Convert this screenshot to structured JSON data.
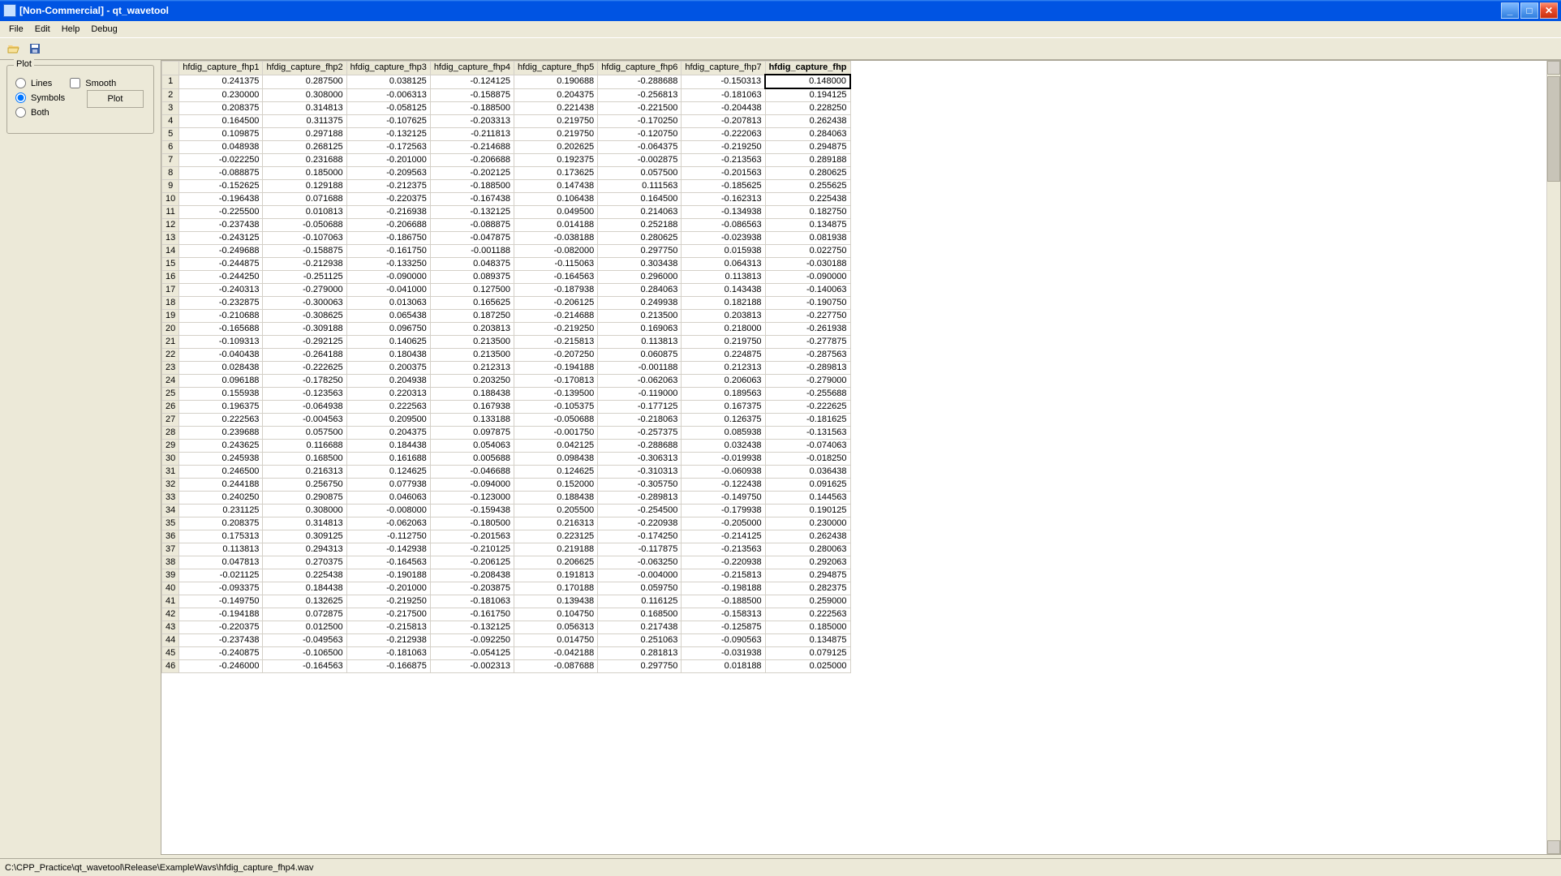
{
  "titlebar": {
    "text": "[Non-Commercial] - qt_wavetool"
  },
  "menu": {
    "file": "File",
    "edit": "Edit",
    "help": "Help",
    "debug": "Debug"
  },
  "plot": {
    "legend": "Plot",
    "lines": "Lines",
    "symbols": "Symbols",
    "both": "Both",
    "smooth": "Smooth",
    "plot_btn": "Plot"
  },
  "table": {
    "selected_col": 8,
    "selected_row": 1,
    "columns": [
      "hfdig_capture_fhp1",
      "hfdig_capture_fhp2",
      "hfdig_capture_fhp3",
      "hfdig_capture_fhp4",
      "hfdig_capture_fhp5",
      "hfdig_capture_fhp6",
      "hfdig_capture_fhp7",
      "hfdig_capture_fhp"
    ],
    "rows": [
      [
        "0.241375",
        "0.287500",
        "0.038125",
        "-0.124125",
        "0.190688",
        "-0.288688",
        "-0.150313",
        "0.148000"
      ],
      [
        "0.230000",
        "0.308000",
        "-0.006313",
        "-0.158875",
        "0.204375",
        "-0.256813",
        "-0.181063",
        "0.194125"
      ],
      [
        "0.208375",
        "0.314813",
        "-0.058125",
        "-0.188500",
        "0.221438",
        "-0.221500",
        "-0.204438",
        "0.228250"
      ],
      [
        "0.164500",
        "0.311375",
        "-0.107625",
        "-0.203313",
        "0.219750",
        "-0.170250",
        "-0.207813",
        "0.262438"
      ],
      [
        "0.109875",
        "0.297188",
        "-0.132125",
        "-0.211813",
        "0.219750",
        "-0.120750",
        "-0.222063",
        "0.284063"
      ],
      [
        "0.048938",
        "0.268125",
        "-0.172563",
        "-0.214688",
        "0.202625",
        "-0.064375",
        "-0.219250",
        "0.294875"
      ],
      [
        "-0.022250",
        "0.231688",
        "-0.201000",
        "-0.206688",
        "0.192375",
        "-0.002875",
        "-0.213563",
        "0.289188"
      ],
      [
        "-0.088875",
        "0.185000",
        "-0.209563",
        "-0.202125",
        "0.173625",
        "0.057500",
        "-0.201563",
        "0.280625"
      ],
      [
        "-0.152625",
        "0.129188",
        "-0.212375",
        "-0.188500",
        "0.147438",
        "0.111563",
        "-0.185625",
        "0.255625"
      ],
      [
        "-0.196438",
        "0.071688",
        "-0.220375",
        "-0.167438",
        "0.106438",
        "0.164500",
        "-0.162313",
        "0.225438"
      ],
      [
        "-0.225500",
        "0.010813",
        "-0.216938",
        "-0.132125",
        "0.049500",
        "0.214063",
        "-0.134938",
        "0.182750"
      ],
      [
        "-0.237438",
        "-0.050688",
        "-0.206688",
        "-0.088875",
        "0.014188",
        "0.252188",
        "-0.086563",
        "0.134875"
      ],
      [
        "-0.243125",
        "-0.107063",
        "-0.186750",
        "-0.047875",
        "-0.038188",
        "0.280625",
        "-0.023938",
        "0.081938"
      ],
      [
        "-0.249688",
        "-0.158875",
        "-0.161750",
        "-0.001188",
        "-0.082000",
        "0.297750",
        "0.015938",
        "0.022750"
      ],
      [
        "-0.244875",
        "-0.212938",
        "-0.133250",
        "0.048375",
        "-0.115063",
        "0.303438",
        "0.064313",
        "-0.030188"
      ],
      [
        "-0.244250",
        "-0.251125",
        "-0.090000",
        "0.089375",
        "-0.164563",
        "0.296000",
        "0.113813",
        "-0.090000"
      ],
      [
        "-0.240313",
        "-0.279000",
        "-0.041000",
        "0.127500",
        "-0.187938",
        "0.284063",
        "0.143438",
        "-0.140063"
      ],
      [
        "-0.232875",
        "-0.300063",
        "0.013063",
        "0.165625",
        "-0.206125",
        "0.249938",
        "0.182188",
        "-0.190750"
      ],
      [
        "-0.210688",
        "-0.308625",
        "0.065438",
        "0.187250",
        "-0.214688",
        "0.213500",
        "0.203813",
        "-0.227750"
      ],
      [
        "-0.165688",
        "-0.309188",
        "0.096750",
        "0.203813",
        "-0.219250",
        "0.169063",
        "0.218000",
        "-0.261938"
      ],
      [
        "-0.109313",
        "-0.292125",
        "0.140625",
        "0.213500",
        "-0.215813",
        "0.113813",
        "0.219750",
        "-0.277875"
      ],
      [
        "-0.040438",
        "-0.264188",
        "0.180438",
        "0.213500",
        "-0.207250",
        "0.060875",
        "0.224875",
        "-0.287563"
      ],
      [
        "0.028438",
        "-0.222625",
        "0.200375",
        "0.212313",
        "-0.194188",
        "-0.001188",
        "0.212313",
        "-0.289813"
      ],
      [
        "0.096188",
        "-0.178250",
        "0.204938",
        "0.203250",
        "-0.170813",
        "-0.062063",
        "0.206063",
        "-0.279000"
      ],
      [
        "0.155938",
        "-0.123563",
        "0.220313",
        "0.188438",
        "-0.139500",
        "-0.119000",
        "0.189563",
        "-0.255688"
      ],
      [
        "0.196375",
        "-0.064938",
        "0.222563",
        "0.167938",
        "-0.105375",
        "-0.177125",
        "0.167375",
        "-0.222625"
      ],
      [
        "0.222563",
        "-0.004563",
        "0.209500",
        "0.133188",
        "-0.050688",
        "-0.218063",
        "0.126375",
        "-0.181625"
      ],
      [
        "0.239688",
        "0.057500",
        "0.204375",
        "0.097875",
        "-0.001750",
        "-0.257375",
        "0.085938",
        "-0.131563"
      ],
      [
        "0.243625",
        "0.116688",
        "0.184438",
        "0.054063",
        "0.042125",
        "-0.288688",
        "0.032438",
        "-0.074063"
      ],
      [
        "0.245938",
        "0.168500",
        "0.161688",
        "0.005688",
        "0.098438",
        "-0.306313",
        "-0.019938",
        "-0.018250"
      ],
      [
        "0.246500",
        "0.216313",
        "0.124625",
        "-0.046688",
        "0.124625",
        "-0.310313",
        "-0.060938",
        "0.036438"
      ],
      [
        "0.244188",
        "0.256750",
        "0.077938",
        "-0.094000",
        "0.152000",
        "-0.305750",
        "-0.122438",
        "0.091625"
      ],
      [
        "0.240250",
        "0.290875",
        "0.046063",
        "-0.123000",
        "0.188438",
        "-0.289813",
        "-0.149750",
        "0.144563"
      ],
      [
        "0.231125",
        "0.308000",
        "-0.008000",
        "-0.159438",
        "0.205500",
        "-0.254500",
        "-0.179938",
        "0.190125"
      ],
      [
        "0.208375",
        "0.314813",
        "-0.062063",
        "-0.180500",
        "0.216313",
        "-0.220938",
        "-0.205000",
        "0.230000"
      ],
      [
        "0.175313",
        "0.309125",
        "-0.112750",
        "-0.201563",
        "0.223125",
        "-0.174250",
        "-0.214125",
        "0.262438"
      ],
      [
        "0.113813",
        "0.294313",
        "-0.142938",
        "-0.210125",
        "0.219188",
        "-0.117875",
        "-0.213563",
        "0.280063"
      ],
      [
        "0.047813",
        "0.270375",
        "-0.164563",
        "-0.206125",
        "0.206625",
        "-0.063250",
        "-0.220938",
        "0.292063"
      ],
      [
        "-0.021125",
        "0.225438",
        "-0.190188",
        "-0.208438",
        "0.191813",
        "-0.004000",
        "-0.215813",
        "0.294875"
      ],
      [
        "-0.093375",
        "0.184438",
        "-0.201000",
        "-0.203875",
        "0.170188",
        "0.059750",
        "-0.198188",
        "0.282375"
      ],
      [
        "-0.149750",
        "0.132625",
        "-0.219250",
        "-0.181063",
        "0.139438",
        "0.116125",
        "-0.188500",
        "0.259000"
      ],
      [
        "-0.194188",
        "0.072875",
        "-0.217500",
        "-0.161750",
        "0.104750",
        "0.168500",
        "-0.158313",
        "0.222563"
      ],
      [
        "-0.220375",
        "0.012500",
        "-0.215813",
        "-0.132125",
        "0.056313",
        "0.217438",
        "-0.125875",
        "0.185000"
      ],
      [
        "-0.237438",
        "-0.049563",
        "-0.212938",
        "-0.092250",
        "0.014750",
        "0.251063",
        "-0.090563",
        "0.134875"
      ],
      [
        "-0.240875",
        "-0.106500",
        "-0.181063",
        "-0.054125",
        "-0.042188",
        "0.281813",
        "-0.031938",
        "0.079125"
      ],
      [
        "-0.246000",
        "-0.164563",
        "-0.166875",
        "-0.002313",
        "-0.087688",
        "0.297750",
        "0.018188",
        "0.025000"
      ]
    ]
  },
  "status": {
    "path": "C:\\CPP_Practice\\qt_wavetool\\Release\\ExampleWavs\\hfdig_capture_fhp4.wav"
  }
}
